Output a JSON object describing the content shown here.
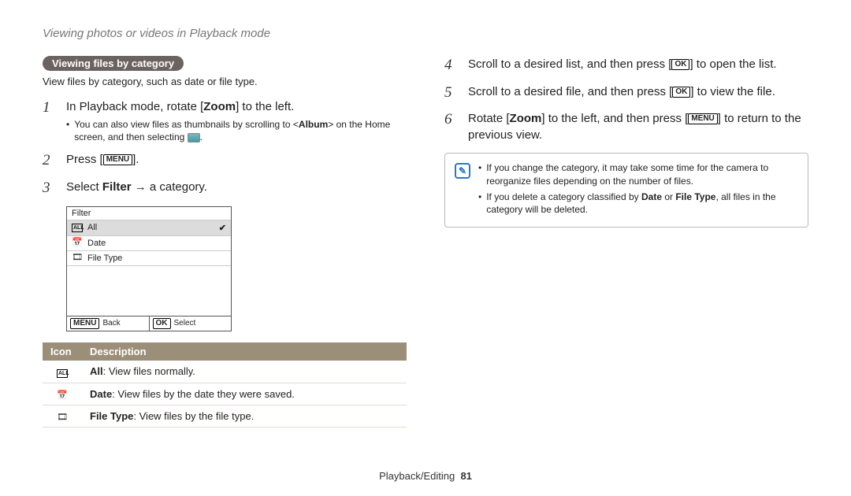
{
  "page_title": "Viewing photos or videos in Playback mode",
  "section": {
    "label": "Viewing files by category",
    "subtitle": "View files by category, such as date or file type."
  },
  "buttons": {
    "ok": "OK",
    "menu": "MENU"
  },
  "left_steps": {
    "s1": {
      "num": "1",
      "pre": "In Playback mode, rotate [",
      "bold": "Zoom",
      "post": "] to the left.",
      "bullet_pre": "You can also view files as thumbnails by scrolling to <",
      "bullet_bold": "Album",
      "bullet_mid": "> on the Home screen, and then selecting ",
      "bullet_post": "."
    },
    "s2": {
      "num": "2",
      "pre": "Press [",
      "post": "]."
    },
    "s3": {
      "num": "3",
      "pre": "Select ",
      "bold": "Filter",
      "mid": " → a category."
    }
  },
  "lcd": {
    "title": "Filter",
    "rows": [
      {
        "icon": "ALL",
        "label": "All",
        "checked": true
      },
      {
        "icon": "📅",
        "label": "Date",
        "checked": false
      },
      {
        "icon": "🎞",
        "label": "File Type",
        "checked": false
      }
    ],
    "footer": {
      "back": "Back",
      "select": "Select"
    }
  },
  "icon_table": {
    "head": {
      "icon": "Icon",
      "desc": "Description"
    },
    "rows": [
      {
        "icon": "ALL",
        "bold": "All",
        "text": ": View files normally."
      },
      {
        "icon": "📅",
        "bold": "Date",
        "text": ": View files by the date they were saved."
      },
      {
        "icon": "🎞",
        "bold": "File Type",
        "text": ": View files by the file type."
      }
    ]
  },
  "right_steps": {
    "s4": {
      "num": "4",
      "pre": "Scroll to a desired list, and then press [",
      "post": "] to open the list."
    },
    "s5": {
      "num": "5",
      "pre": "Scroll to a desired file, and then press [",
      "post": "] to view the file."
    },
    "s6": {
      "num": "6",
      "pre": "Rotate [",
      "bold": "Zoom",
      "mid": "] to the left, and then press [",
      "post": "] to return to the previous view."
    }
  },
  "notes": {
    "n1": "If you change the category, it may take some time for the camera to reorganize files depending on the number of files.",
    "n2_pre": "If you delete a category classified by ",
    "n2_b1": "Date",
    "n2_mid": " or ",
    "n2_b2": "File Type",
    "n2_post": ", all files in the category will be deleted."
  },
  "footer": {
    "section": "Playback/Editing",
    "page": "81"
  }
}
